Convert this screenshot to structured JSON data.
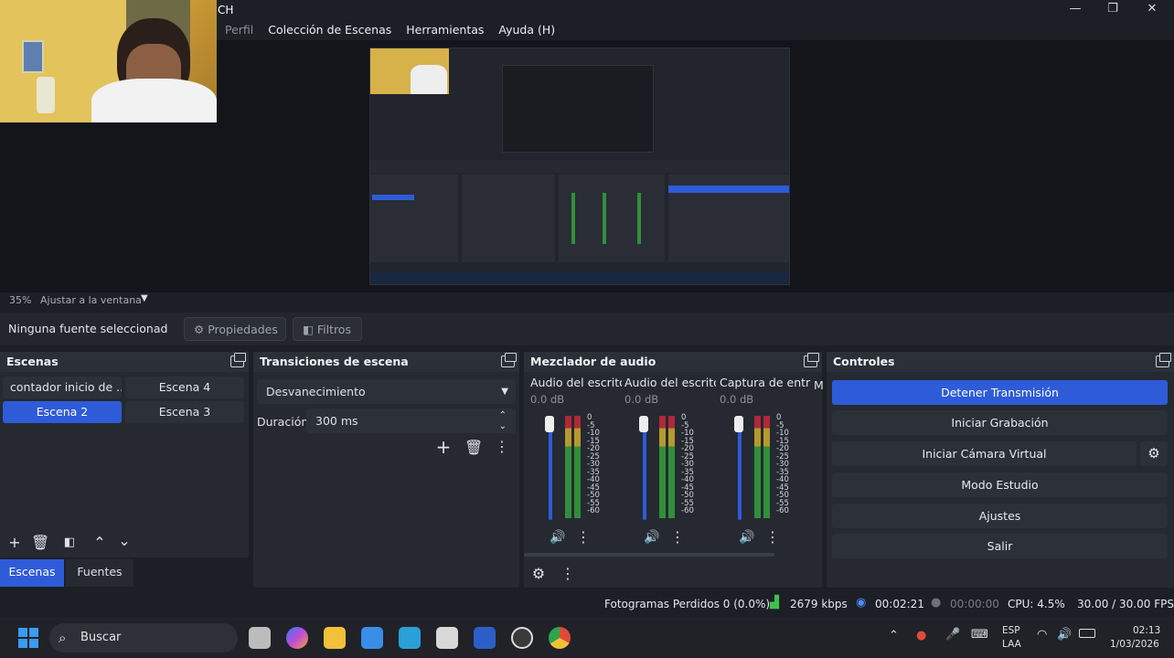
{
  "window": {
    "title": "CH",
    "minimize": "—",
    "maximize": "❐",
    "close": "✕"
  },
  "menu": [
    "Perfil",
    "Colección de Escenas",
    "Herramientas",
    "Ayuda (H)"
  ],
  "preview": {
    "zoom": "35%",
    "fit": "Ajustar a la ventana"
  },
  "sourcebar": {
    "no_source": "Ninguna fuente seleccionad",
    "properties": "Propiedades",
    "filters": "Filtros"
  },
  "scenes": {
    "title": "Escenas",
    "items": [
      "contador inicio de ...",
      "Escena 4",
      "Escena 2",
      "Escena 3"
    ],
    "selected": "Escena 2",
    "tab_scenes": "Escenas",
    "tab_sources": "Fuentes"
  },
  "transitions": {
    "title": "Transiciones de escena",
    "type": "Desvanecimiento",
    "duration_label": "Duración",
    "duration": "300 ms"
  },
  "mixer": {
    "title": "Mezclador de audio",
    "channels": [
      {
        "name": "Audio del escrito",
        "db": "0.0 dB"
      },
      {
        "name": "Audio del escrito",
        "db": "0.0 dB"
      },
      {
        "name": "Captura de entra",
        "db": "0.0 dB"
      }
    ],
    "partial": "M",
    "scale": [
      "0",
      "-5",
      "-10",
      "-15",
      "-20",
      "-25",
      "-30",
      "-35",
      "-40",
      "-45",
      "-50",
      "-55",
      "-60"
    ]
  },
  "controls": {
    "title": "Controles",
    "stop_stream": "Detener Transmisión",
    "start_rec": "Iniciar Grabación",
    "virtual_cam": "Iniciar Cámara Virtual",
    "studio": "Modo Estudio",
    "settings": "Ajustes",
    "exit": "Salir"
  },
  "status": {
    "dropped": "Fotogramas Perdidos 0 (0.0%)",
    "bitrate": "2679 kbps",
    "stream_time": "00:02:21",
    "rec_time": "00:00:00",
    "cpu": "CPU: 4.5%",
    "fps": "30.00 / 30.00 FPS"
  },
  "taskbar": {
    "search": "Buscar",
    "lang1": "ESP",
    "lang2": "LAA",
    "time": "02:13",
    "date": "1/03/2026"
  },
  "colors": {
    "accent": "#2e5bd8",
    "panel": "#262931",
    "background": "#1d1f26"
  }
}
